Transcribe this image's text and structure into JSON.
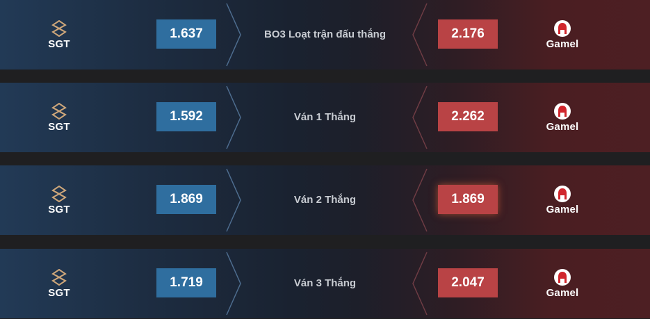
{
  "rows": [
    {
      "left_team": "SGT",
      "left_odds": "1.637",
      "market": "BO3 Loạt trận đấu thắng",
      "right_odds": "2.176",
      "right_team": "Gamel",
      "left_logo_icon": "sgt-logo-icon",
      "right_logo_icon": "gamel-logo-icon"
    },
    {
      "left_team": "SGT",
      "left_odds": "1.592",
      "market": "Ván 1 Thắng",
      "right_odds": "2.262",
      "right_team": "Gamel",
      "left_logo_icon": "sgt-logo-icon",
      "right_logo_icon": "gamel-logo-icon"
    },
    {
      "left_team": "SGT",
      "left_odds": "1.869",
      "market": "Ván 2 Thắng",
      "right_odds": "1.869",
      "right_team": "Gamel",
      "left_logo_icon": "sgt-logo-icon",
      "right_logo_icon": "gamel-logo-icon"
    },
    {
      "left_team": "SGT",
      "left_odds": "1.719",
      "market": "Ván 3 Thắng",
      "right_odds": "2.047",
      "right_team": "Gamel",
      "left_logo_icon": "sgt-logo-icon",
      "right_logo_icon": "gamel-logo-icon"
    }
  ],
  "colors": {
    "left_odds_bg": "#2f6e9f",
    "right_odds_bg": "#b94345",
    "separator": "#1f1f21"
  }
}
